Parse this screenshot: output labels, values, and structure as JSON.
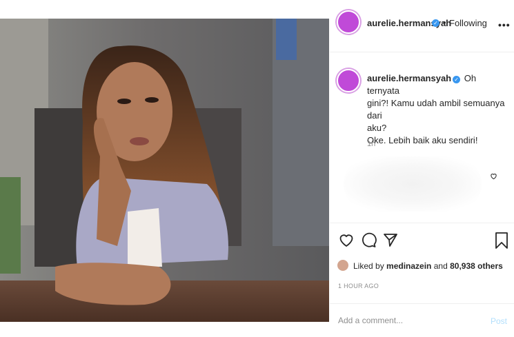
{
  "post": {
    "username": "aurelie.hermansyah",
    "separator": "•",
    "follow_status": "Following",
    "more_label": "•••"
  },
  "caption": {
    "username": "aurelie.hermansyah",
    "line1": "Oh ternyata",
    "line2": "gini?! Kamu udah ambil semuanya dari",
    "line3": "aku?",
    "line4": "Oke. Lebih baik aku sendiri!",
    "time": "1h"
  },
  "likes": {
    "liked_by_prefix": "Liked by ",
    "liker": "medinazein",
    "connector": " and ",
    "others": "80,938 others"
  },
  "timestamp": "1 HOUR AGO",
  "comment": {
    "placeholder": "Add a comment...",
    "post_label": "Post"
  },
  "colors": {
    "avatar": "#c04ad8",
    "verified": "#3897f0",
    "post_button": "#b2dffc"
  },
  "icons": {
    "like": "heart-icon",
    "comment": "comment-icon",
    "share": "paper-plane-icon",
    "save": "bookmark-icon",
    "verified": "verified-badge-icon",
    "comment_like": "heart-icon"
  }
}
